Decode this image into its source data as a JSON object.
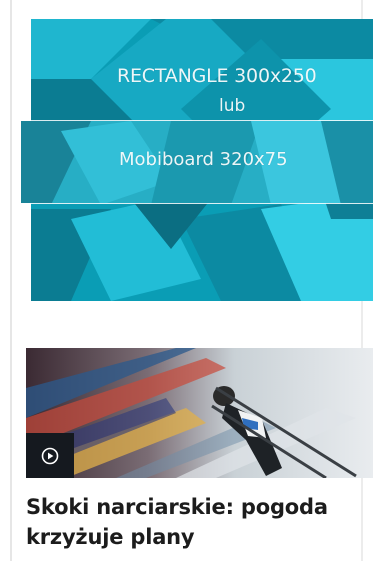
{
  "ad": {
    "line1": "RECTANGLE 300x250",
    "line2": "lub",
    "line3": "Mobiboard 320x75",
    "colors": {
      "base": "#0a9db5",
      "light": "#2fc3dc",
      "dark": "#0b6e82"
    }
  },
  "article": {
    "image_icon": "play-circle-icon",
    "headline": "Skoki narciarskie: pogoda krzyżuje plany"
  }
}
